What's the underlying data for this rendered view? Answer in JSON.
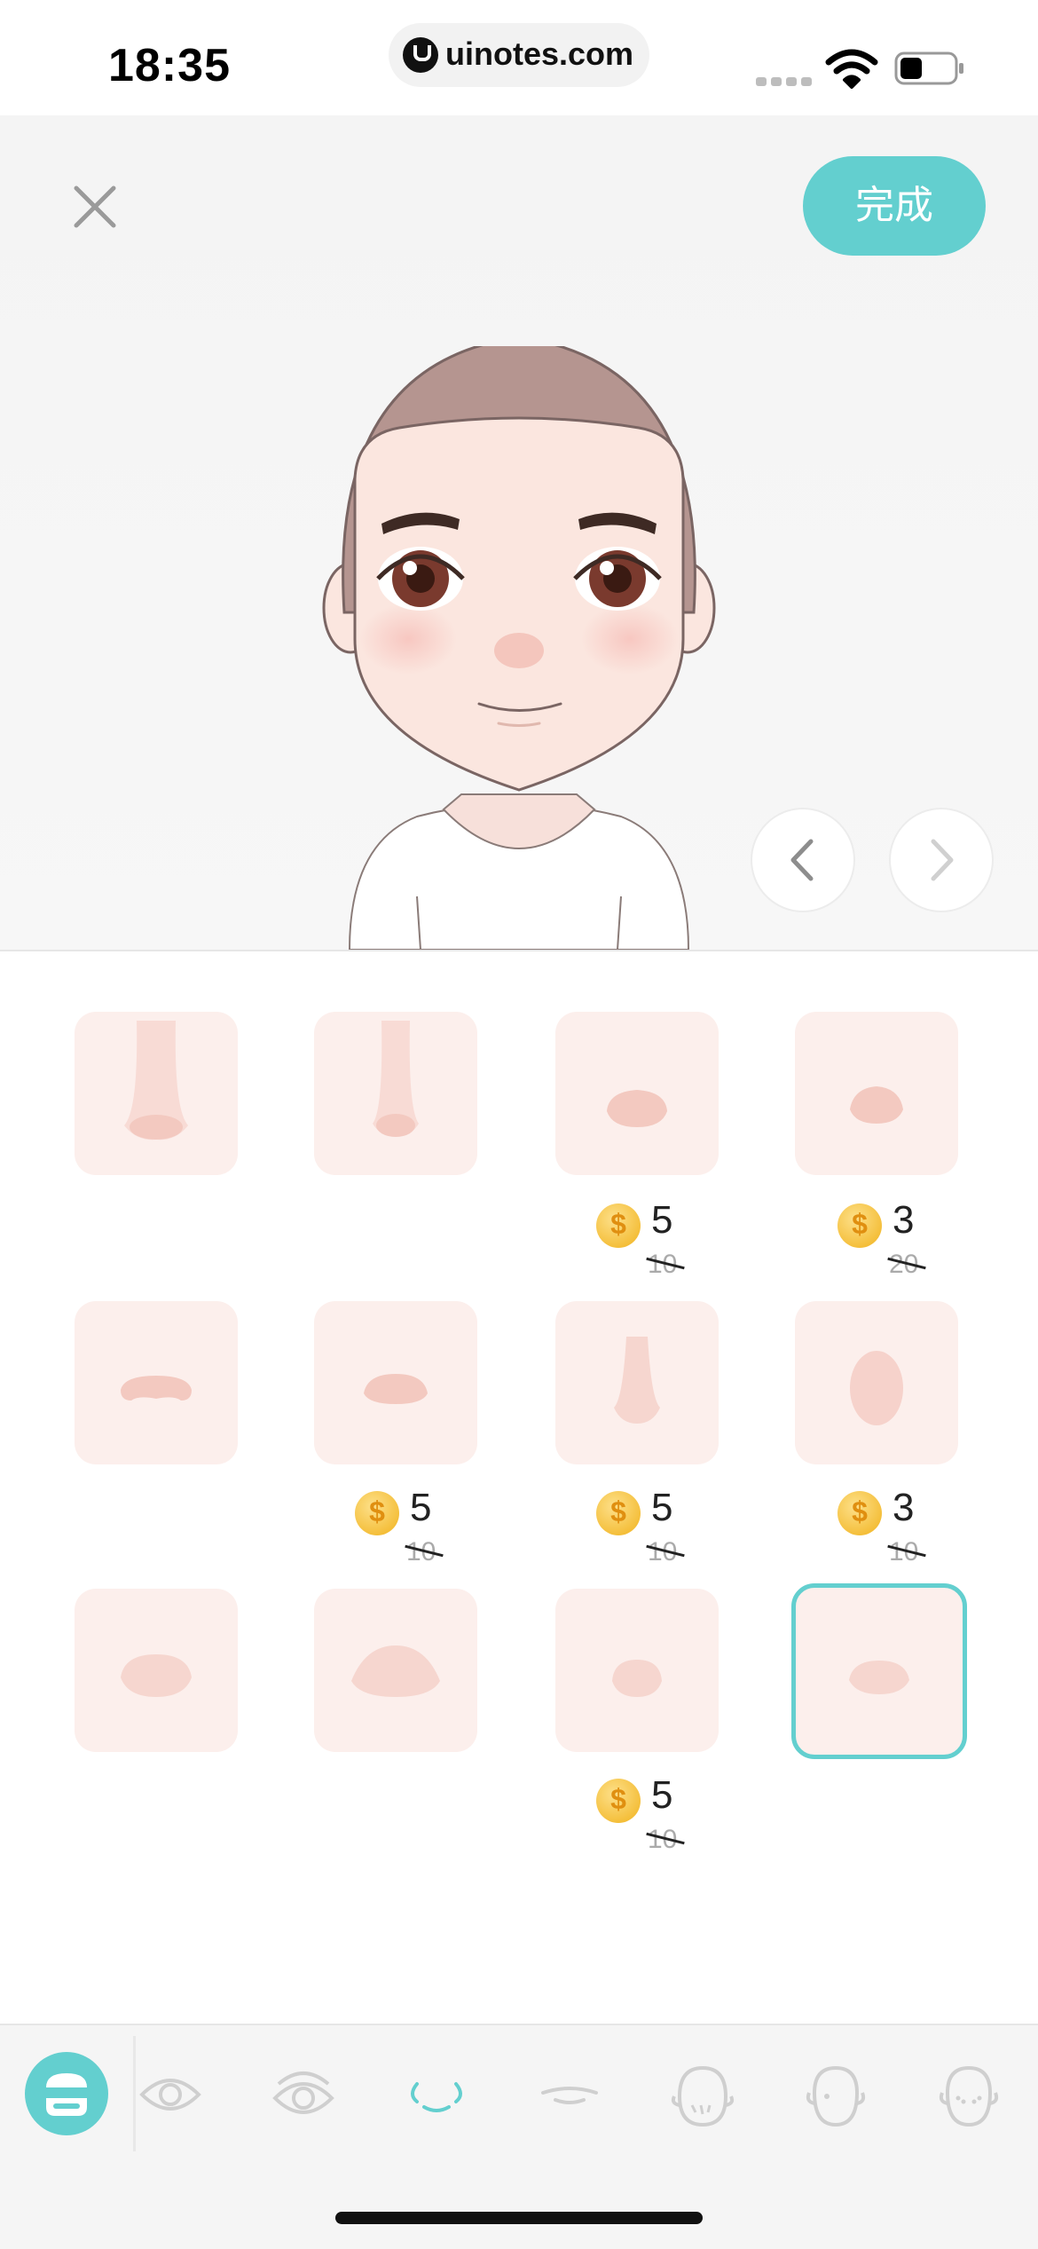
{
  "status_bar": {
    "time": "18:35",
    "url": "uinotes.com"
  },
  "header": {
    "done_label": "完成"
  },
  "colors": {
    "accent": "#63cfcf",
    "tile": "#fcefec",
    "coin": "#f1b21c"
  },
  "grid": {
    "items": [
      {
        "price": null,
        "original": null,
        "selected": false
      },
      {
        "price": null,
        "original": null,
        "selected": false
      },
      {
        "price": "5",
        "original": "10",
        "selected": false
      },
      {
        "price": "3",
        "original": "20",
        "selected": false
      },
      {
        "price": null,
        "original": null,
        "selected": false
      },
      {
        "price": "5",
        "original": "10",
        "selected": false
      },
      {
        "price": "5",
        "original": "10",
        "selected": false
      },
      {
        "price": "3",
        "original": "10",
        "selected": false
      },
      {
        "price": null,
        "original": null,
        "selected": false
      },
      {
        "price": null,
        "original": null,
        "selected": false
      },
      {
        "price": "5",
        "original": "10",
        "selected": false
      },
      {
        "price": null,
        "original": null,
        "selected": true
      }
    ]
  },
  "tabs": [
    {
      "icon": "mask-icon",
      "active": true
    },
    {
      "icon": "eye-icon",
      "active": false
    },
    {
      "icon": "eye-lashes-icon",
      "active": false
    },
    {
      "icon": "nose-icon",
      "active": true
    },
    {
      "icon": "mouth-icon",
      "active": false
    },
    {
      "icon": "beard-face-icon",
      "active": false
    },
    {
      "icon": "face-shape-icon",
      "active": false
    },
    {
      "icon": "freckles-face-icon",
      "active": false
    }
  ]
}
